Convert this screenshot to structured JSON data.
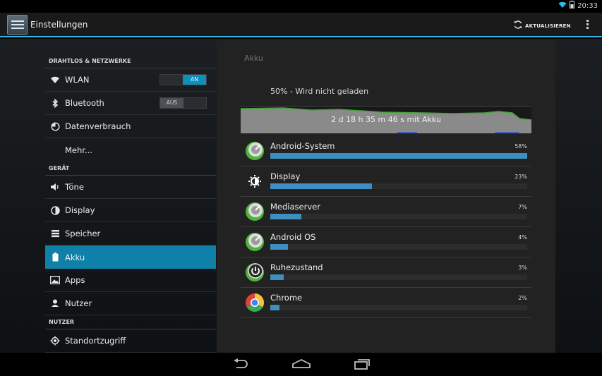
{
  "status": {
    "time": "20:33"
  },
  "action_bar": {
    "title": "Einstellungen",
    "refresh_label": "AKTUALISIEREN"
  },
  "nav": {
    "sections": [
      {
        "header": "DRAHTLOS & NETZWERKE"
      },
      {
        "header": "GERÄT"
      },
      {
        "header": "NUTZER"
      }
    ],
    "items": [
      {
        "label": "WLAN",
        "icon": "wifi-icon",
        "toggle": "AN"
      },
      {
        "label": "Bluetooth",
        "icon": "bluetooth-icon",
        "toggle": "AUS"
      },
      {
        "label": "Datenverbrauch",
        "icon": "data-usage-icon"
      },
      {
        "label": "Mehr..."
      },
      {
        "label": "Töne",
        "icon": "sound-icon"
      },
      {
        "label": "Display",
        "icon": "brightness-icon"
      },
      {
        "label": "Speicher",
        "icon": "storage-icon"
      },
      {
        "label": "Akku",
        "icon": "battery-icon",
        "active": true
      },
      {
        "label": "Apps",
        "icon": "apps-icon"
      },
      {
        "label": "Nutzer",
        "icon": "user-icon"
      },
      {
        "label": "Standortzugriff",
        "icon": "location-icon"
      }
    ]
  },
  "detail": {
    "title": "Akku",
    "charge_status": "50% - Wird nicht geladen",
    "graph_label": "2 d 18 h 35 m 46 s mit Akku",
    "usage": [
      {
        "name": "Android-System",
        "percent_label": "58%",
        "percent": 58,
        "icon": "android-system-icon"
      },
      {
        "name": "Display",
        "percent_label": "23%",
        "percent": 23,
        "icon": "brightness-icon"
      },
      {
        "name": "Mediaserver",
        "percent_label": "7%",
        "percent": 7,
        "icon": "android-icon"
      },
      {
        "name": "Android OS",
        "percent_label": "4%",
        "percent": 4,
        "icon": "android-icon"
      },
      {
        "name": "Ruhezustand",
        "percent_label": "3%",
        "percent": 3,
        "icon": "power-icon"
      },
      {
        "name": "Chrome",
        "percent_label": "2%",
        "percent": 2,
        "icon": "chrome-icon"
      }
    ]
  },
  "colors": {
    "accent": "#33b5e5",
    "active_item": "#0f81a9",
    "usage_bar": "#3d8fc0",
    "graph_line": "#3fa535"
  }
}
